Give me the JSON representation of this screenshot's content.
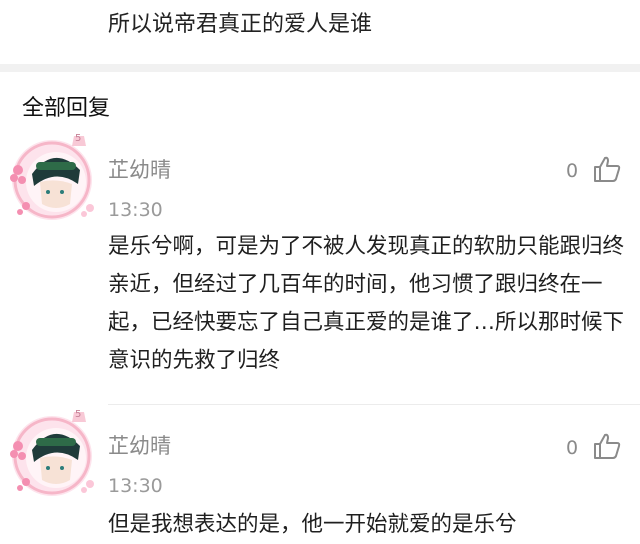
{
  "top_post": {
    "text": "所以说帝君真正的爱人是谁"
  },
  "section": {
    "title": "全部回复"
  },
  "comments": [
    {
      "username": "芷幼晴",
      "time": "13:30",
      "likes": "0",
      "level_badge": "5",
      "body": "是乐兮啊，可是为了不被人发现真正的软肋只能跟归终亲近，但经过了几百年的时间，他习惯了跟归终在一起，已经快要忘了自己真正爱的是谁了…所以那时候下意识的先救了归终"
    },
    {
      "username": "芷幼晴",
      "time": "13:30",
      "likes": "0",
      "level_badge": "5",
      "body": "但是我想表达的是，他一开始就爱的是乐兮"
    }
  ],
  "icons": {
    "avatar": "anime-avatar-with-flower-frame",
    "like": "thumbs-up-icon"
  },
  "colors": {
    "meta_text": "#8a8a8a",
    "frame_pink": "#f6b6c8",
    "divider": "#f1f1f1"
  }
}
